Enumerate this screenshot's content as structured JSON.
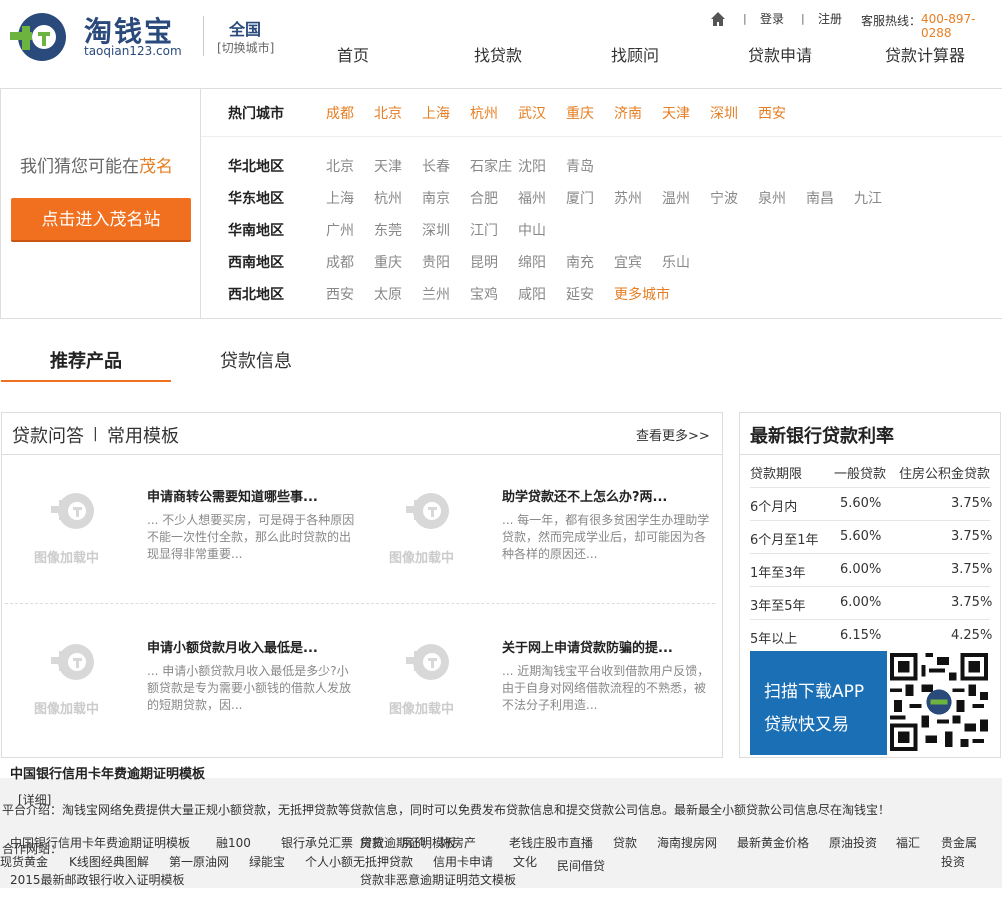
{
  "header": {
    "logo_cn": "淘钱宝",
    "logo_en": "taoqian123.com",
    "city": "全国",
    "city_switch": "[切换城市]",
    "login": "登录",
    "register": "注册",
    "hotline_label": "客服热线：",
    "hotline": "400-897-0288",
    "nav": [
      "首页",
      "找贷款",
      "找顾问",
      "贷款申请",
      "贷款计算器"
    ]
  },
  "city_panel": {
    "guess_prefix": "我们猜您可能在",
    "guess_city": "茂名",
    "enter_btn": "点击进入茂名站",
    "hot_label": "热门城市",
    "hot_cities": [
      "成都",
      "北京",
      "上海",
      "杭州",
      "武汉",
      "重庆",
      "济南",
      "天津",
      "深圳",
      "西安"
    ],
    "regions": [
      {
        "name": "华北地区",
        "cities": [
          "北京",
          "天津",
          "长春",
          "石家庄",
          "沈阳",
          "青岛"
        ]
      },
      {
        "name": "华东地区",
        "cities": [
          "上海",
          "杭州",
          "南京",
          "合肥",
          "福州",
          "厦门",
          "苏州",
          "温州",
          "宁波",
          "泉州",
          "南昌",
          "九江"
        ]
      },
      {
        "name": "华南地区",
        "cities": [
          "广州",
          "东莞",
          "深圳",
          "江门",
          "中山"
        ]
      },
      {
        "name": "西南地区",
        "cities": [
          "成都",
          "重庆",
          "贵阳",
          "昆明",
          "绵阳",
          "南充",
          "宜宾",
          "乐山"
        ]
      },
      {
        "name": "西北地区",
        "cities": [
          "西安",
          "太原",
          "兰州",
          "宝鸡",
          "咸阳",
          "延安"
        ]
      }
    ],
    "more_cities": "更多城市"
  },
  "tabs": [
    "推荐产品",
    "贷款信息"
  ],
  "qa": {
    "title1": "贷款问答",
    "bar": "|",
    "title2": "常用模板",
    "more": "查看更多>>",
    "thumb_text": "图像加载中",
    "articles": [
      {
        "title": "申请商转公需要知道哪些事...",
        "desc": "... 不少人想要买房，可是碍于各种原因不能一次性付全款，那么此时贷款的出现显得非常重要..."
      },
      {
        "title": "助学贷款还不上怎么办?两...",
        "desc": "... 每一年，都有很多贫困学生办理助学贷款，然而完成学业后，却可能因为各种各样的原因还..."
      },
      {
        "title": "申请小额贷款月收入最低是...",
        "desc": "... 申请小额贷款月收入最低是多少?小额贷款是专为需要小额钱的借款人发放的短期贷款，因..."
      },
      {
        "title": "关于网上申请贷款防骗的提...",
        "desc": "... 近期淘钱宝平台收到借款用户反馈，由于自身对网络借款流程的不熟悉，被不法分子利用造..."
      }
    ]
  },
  "rates": {
    "title": "最新银行贷款利率",
    "headers": [
      "贷款期限",
      "一般贷款",
      "住房公积金贷款"
    ],
    "rows": [
      [
        "6个月内",
        "5.60%",
        "3.75%"
      ],
      [
        "6个月至1年",
        "5.60%",
        "3.75%"
      ],
      [
        "1年至3年",
        "6.00%",
        "3.75%"
      ],
      [
        "3年至5年",
        "6.00%",
        "3.75%"
      ],
      [
        "5年以上",
        "6.15%",
        "4.25%"
      ]
    ],
    "app_l1": "扫描下载APP",
    "app_l2": "贷款快又易"
  },
  "footer": {
    "t1": "中国银行信用卡年费逾期证明模板",
    "detail": "[详细]",
    "intro": "平台介绍：淘钱宝网络免费提供大量正规小额贷款，无抵押贷款等贷款信息，同时可以免费发布贷款信息和提交贷款公司信息。最新最全小额贷款公司信息尽在淘钱宝！",
    "partner": "合作网站：",
    "t2": "中国银行信用卡年费逾期证明模板",
    "t3": "贷款逾期证明模板",
    "links1": [
      "融100",
      "银行承兑汇票",
      "房贷",
      "房价",
      "好房产",
      "老钱庄股市直播",
      "贷款",
      "海南搜房网",
      "最新黄金价格",
      "原油投资",
      "福汇",
      "贵金属"
    ],
    "links2": [
      "现货黄金",
      "K线图经典图解",
      "第一原油网",
      "绿能宝",
      "个人小额无抵押贷款",
      "信用卡申请",
      "文化",
      "民间借贷",
      "投资"
    ],
    "t4": "2015最新邮政银行收入证明模板",
    "t5": "贷款非恶意逾期证明范文模板"
  }
}
